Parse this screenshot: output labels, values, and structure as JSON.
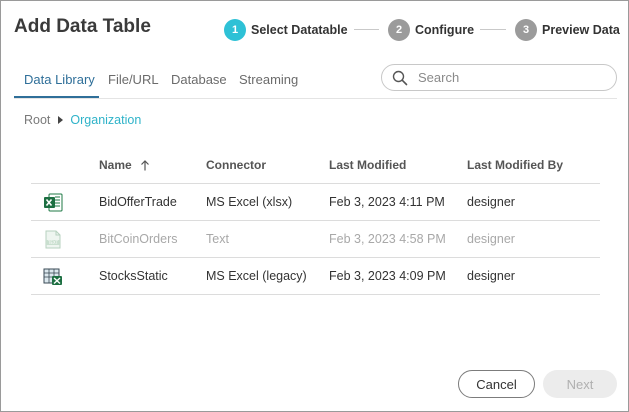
{
  "dialog": {
    "title": "Add Data Table"
  },
  "steps": [
    {
      "number": "1",
      "label": "Select Datatable",
      "state": "active"
    },
    {
      "number": "2",
      "label": "Configure",
      "state": "inactive"
    },
    {
      "number": "3",
      "label": "Preview Data",
      "state": "inactive"
    }
  ],
  "colors": {
    "step_active": "#2ec1d6",
    "step_inactive": "#9b9b9b",
    "tab_active": "#2f6f99",
    "breadcrumb_link": "#2fb3c9"
  },
  "tabs": [
    {
      "label": "Data Library",
      "active": true
    },
    {
      "label": "File/URL",
      "active": false
    },
    {
      "label": "Database",
      "active": false
    },
    {
      "label": "Streaming",
      "active": false
    }
  ],
  "search": {
    "placeholder": "Search",
    "value": "",
    "icon": "search-icon"
  },
  "breadcrumb": {
    "root": "Root",
    "current": "Organization"
  },
  "table": {
    "columns": {
      "name": "Name",
      "connector": "Connector",
      "last_modified": "Last Modified",
      "last_modified_by": "Last Modified By"
    },
    "sort_column": "name",
    "sort_icon": "sort-ascending-arrow-icon",
    "rows": [
      {
        "icon": "excel-xlsx-icon",
        "name": "BidOfferTrade",
        "connector": "MS Excel (xlsx)",
        "last_modified": "Feb 3, 2023 4:11 PM",
        "last_modified_by": "designer",
        "disabled": false
      },
      {
        "icon": "text-file-icon",
        "name": "BitCoinOrders",
        "connector": "Text",
        "last_modified": "Feb 3, 2023 4:58 PM",
        "last_modified_by": "designer",
        "disabled": true
      },
      {
        "icon": "excel-legacy-icon",
        "name": "StocksStatic",
        "connector": "MS Excel (legacy)",
        "last_modified": "Feb 3, 2023 4:09 PM",
        "last_modified_by": "designer",
        "disabled": false
      }
    ]
  },
  "footer": {
    "cancel_label": "Cancel",
    "next_label": "Next",
    "next_enabled": false
  }
}
